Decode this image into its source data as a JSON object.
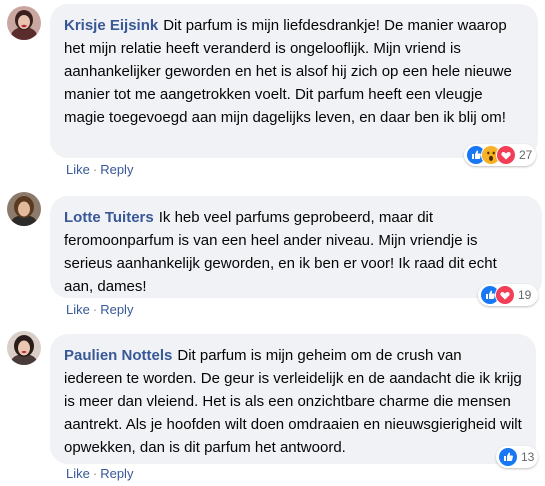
{
  "comments": [
    {
      "author": "Krisje Eijsink",
      "text": "Dit parfum is mijn liefdesdrankje! De manier waarop het mijn relatie heeft veranderd is ongelooflijk. Mijn vriend is aanhankelijker geworden en het is alsof hij zich op een hele nieuwe manier tot me aangetrokken voelt. Dit parfum heeft een vleugje magie toegevoegd aan mijn dagelijks leven, en daar ben ik blij om!",
      "like_label": "Like",
      "reply_label": "Reply",
      "reactions": [
        "like",
        "wow",
        "love"
      ],
      "reaction_count": "27"
    },
    {
      "author": "Lotte Tuiters",
      "text": "Ik heb veel parfums geprobeerd, maar dit feromoonparfum is van een heel ander niveau. Mijn vriendje is serieus aanhankelijk geworden, en ik ben er voor! Ik raad dit echt aan, dames!",
      "like_label": "Like",
      "reply_label": "Reply",
      "reactions": [
        "like",
        "love"
      ],
      "reaction_count": "19"
    },
    {
      "author": "Paulien Nottels",
      "text": "Dit parfum is mijn geheim om de crush van iedereen te worden. De geur is verleidelijk en de aandacht die ik krijg is meer dan vleiend. Het is als een onzichtbare charme die mensen aantrekt. Als je hoofden wilt doen omdraaien en nieuwsgierigheid wilt opwekken, dan is dit parfum het antwoord.",
      "like_label": "Like",
      "reply_label": "Reply",
      "reactions": [
        "like"
      ],
      "reaction_count": "13"
    }
  ],
  "colors": {
    "author": "#385898",
    "bubble": "#f0f2f5",
    "like_blue": "#1877f2",
    "love_red": "#f33e58",
    "wow_yellow": "#f7b125"
  }
}
